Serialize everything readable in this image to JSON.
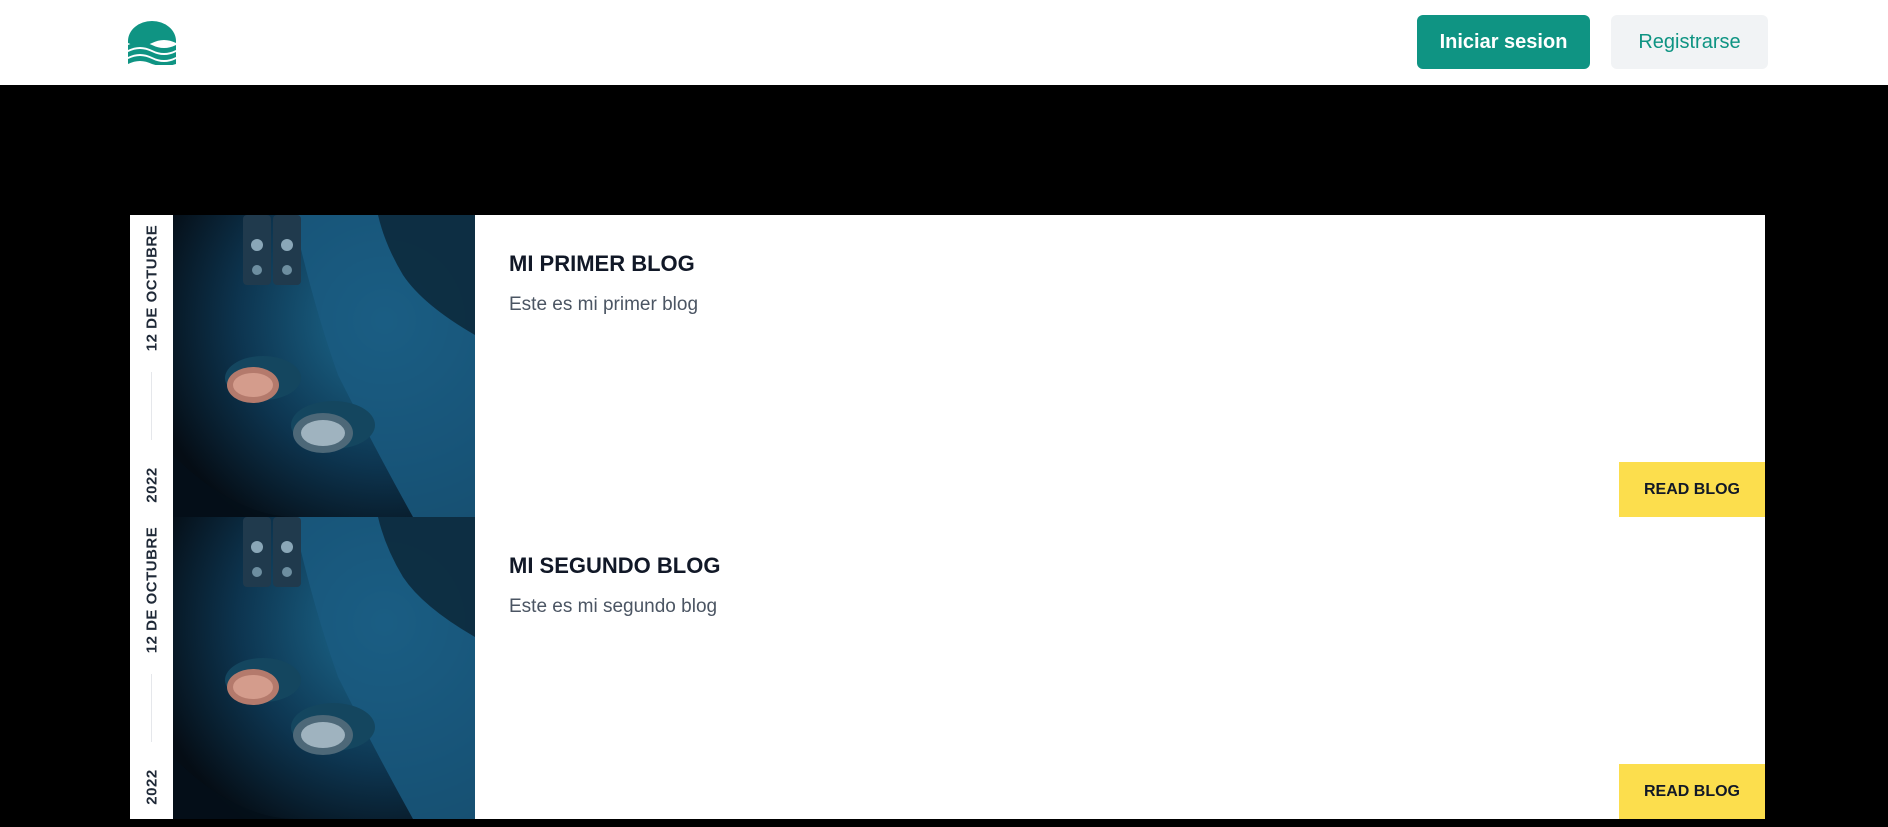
{
  "header": {
    "logo_icon": "waves-logo-icon",
    "login_label": "Iniciar sesion",
    "register_label": "Registrarse",
    "brand_color": "#0f9483"
  },
  "posts": [
    {
      "date_text": "12 DE OCTUBRE",
      "year": "2022",
      "image_icon": "guitar-photo",
      "title": "MI PRIMER BLOG",
      "excerpt": "Este es mi primer blog",
      "cta_label": "READ BLOG"
    },
    {
      "date_text": "12 DE OCTUBRE",
      "year": "2022",
      "image_icon": "guitar-photo",
      "title": "MI SEGUNDO BLOG",
      "excerpt": "Este es mi segundo blog",
      "cta_label": "READ BLOG"
    }
  ],
  "colors": {
    "page_background": "#000000",
    "cta_background": "#fcde4d"
  }
}
